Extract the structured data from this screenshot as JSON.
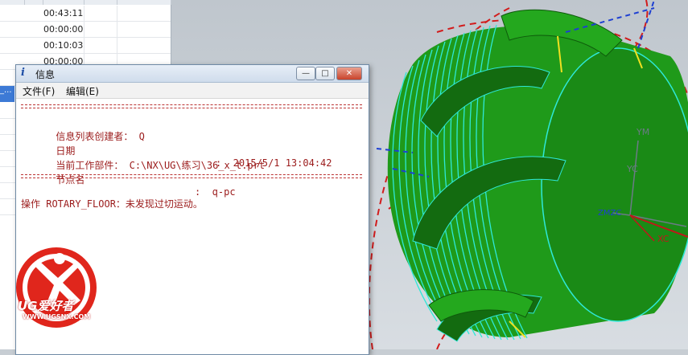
{
  "navigator": {
    "times": [
      "00:43:11",
      "00:00:00",
      "00:10:03",
      "00:00:00"
    ],
    "selected_marker": "_..."
  },
  "info_window": {
    "icon": "i",
    "title": "信息",
    "menu": {
      "file": "文件(F)",
      "edit": "编辑(E)"
    },
    "creator_label": "信息列表创建者：",
    "creator_value": "Q",
    "date_label": "日期",
    "date_value": ":  2015/5/1 13:04:42",
    "part_label": "当前工作部件：",
    "part_value": "C:\\NX\\UG\\练习\\36_x_t.prt",
    "node_label": "节点名",
    "node_value": ":  q-pc",
    "operation_message": "操作 ROTARY_FLOOR：未发现过切运动。"
  },
  "viewport": {
    "axis_labels": {
      "ym": "YM",
      "yc": "YC",
      "zmzc": "ZMZC",
      "xc": "XC"
    }
  },
  "logo": {
    "text": "UG爱好者",
    "url": "WWW.UGSNX.COM"
  },
  "colors": {
    "part_green": "#1f9a1a",
    "toolpath_cyan": "#2ee8d8",
    "info_text": "#9b1b1b",
    "logo_red": "#e0261c"
  }
}
